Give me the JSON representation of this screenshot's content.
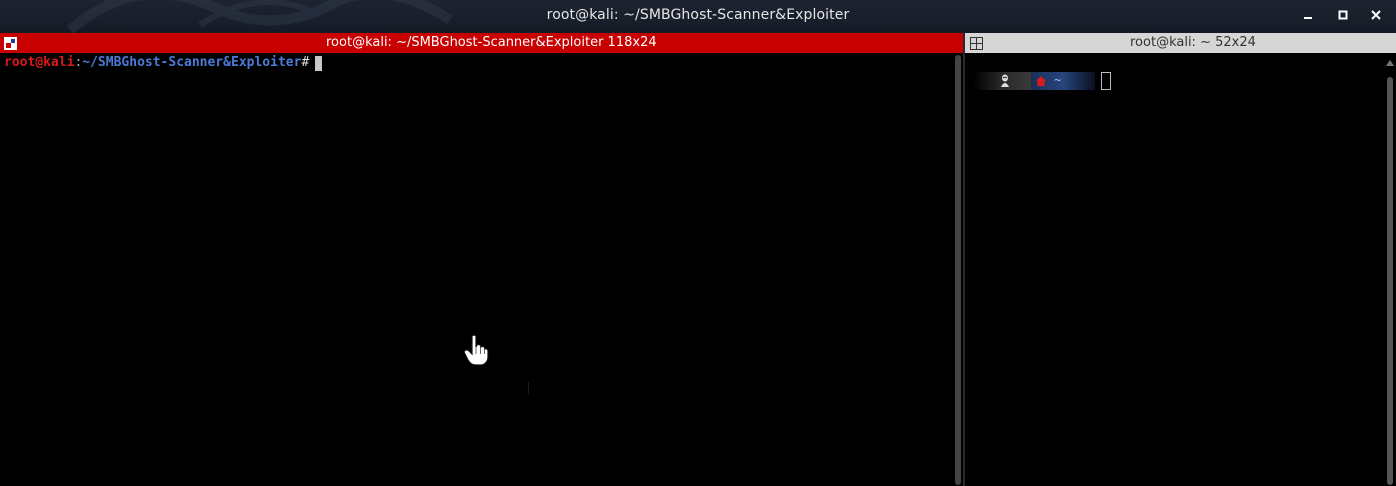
{
  "window": {
    "title": "root@kali: ~/SMBGhost-Scanner&Exploiter",
    "controls": [
      "minimize-icon",
      "maximize-icon",
      "close-icon"
    ]
  },
  "left_pane": {
    "title": "root@kali: ~/SMBGhost-Scanner&Exploiter 118x24",
    "title_bg": "#c80000",
    "prompt": {
      "user": "root@kali",
      "colon": ":",
      "path": "~/SMBGhost-Scanner&Exploiter",
      "symbol": "#"
    }
  },
  "right_pane": {
    "title": "root@kali: ~ 52x24",
    "title_bg": "#d6d6d6",
    "prompt_bar": {
      "os_icon": "linux-tux-icon",
      "home_icon": "home-icon",
      "dir": "~"
    }
  },
  "colors": {
    "prompt_user": "#d81b1b",
    "prompt_path": "#4b7bd6",
    "terminal_bg": "#000000"
  }
}
